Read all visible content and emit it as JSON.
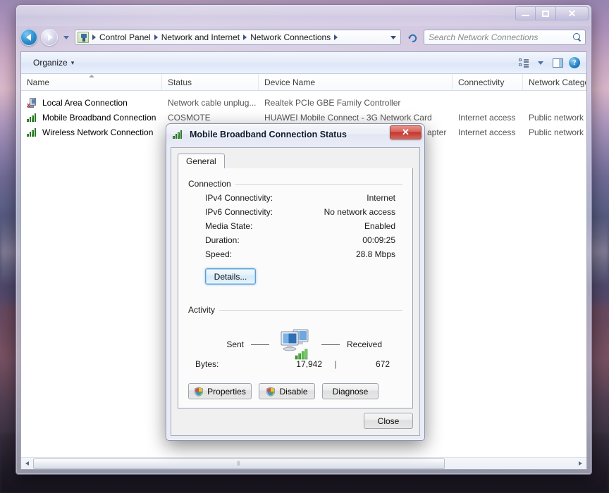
{
  "window": {
    "title": "",
    "controls": {
      "minimize": "–",
      "maximize": "□",
      "close": "✕"
    },
    "address": {
      "crumbs": [
        "Control Panel",
        "Network and Internet",
        "Network Connections"
      ],
      "refresh_label": "↻"
    },
    "search": {
      "placeholder": "Search Network Connections"
    },
    "toolbar": {
      "organize_label": "Organize",
      "organize_caret": "▾"
    }
  },
  "list": {
    "columns": [
      "Name",
      "Status",
      "Device Name",
      "Connectivity",
      "Network Category"
    ],
    "rows": [
      {
        "icon": "network-card-disconnected-icon",
        "name": "Local Area Connection",
        "status": "Network cable unplug...",
        "device": "Realtek PCIe GBE Family Controller",
        "connectivity": "",
        "category": ""
      },
      {
        "icon": "signal-bars-icon",
        "name": "Mobile Broadband Connection",
        "status": "COSMOTE",
        "device": "HUAWEI Mobile Connect - 3G Network Card",
        "connectivity": "Internet access",
        "category": "Public network"
      },
      {
        "icon": "signal-bars-icon",
        "name": "Wireless Network Connection",
        "status": "",
        "device": "apter",
        "connectivity": "Internet access",
        "category": "Public network"
      }
    ],
    "scroll_grip": "‖"
  },
  "dialog": {
    "title": "Mobile Broadband Connection Status",
    "close_glyph": "✕",
    "tabs": [
      {
        "label": "General",
        "active": true
      }
    ],
    "connection": {
      "legend": "Connection",
      "fields": [
        {
          "label": "IPv4 Connectivity:",
          "value": "Internet"
        },
        {
          "label": "IPv6 Connectivity:",
          "value": "No network access"
        },
        {
          "label": "Media State:",
          "value": "Enabled"
        },
        {
          "label": "Duration:",
          "value": "00:09:25"
        },
        {
          "label": "Speed:",
          "value": "28.8 Mbps"
        }
      ],
      "details_button": "Details..."
    },
    "activity": {
      "legend": "Activity",
      "sent_label": "Sent",
      "received_label": "Received",
      "bytes_label": "Bytes:",
      "bytes_sent": "17,942",
      "bytes_separator": "|",
      "bytes_received": "672"
    },
    "buttons": {
      "properties": "Properties",
      "disable": "Disable",
      "diagnose": "Diagnose",
      "close": "Close"
    }
  },
  "colors": {
    "accent_blue": "#2b86c8",
    "signal_green": "#2f8c2a",
    "close_red": "#c4352c",
    "focus_blue": "#5b9fd4"
  }
}
